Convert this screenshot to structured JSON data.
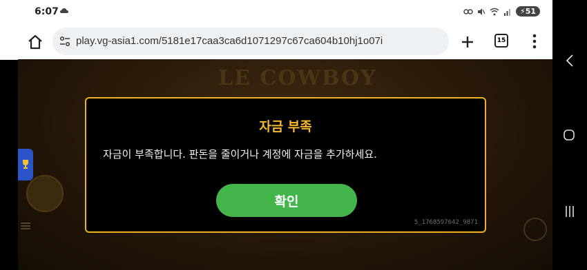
{
  "status": {
    "time": "6:07",
    "battery": "51"
  },
  "browser": {
    "url": "play.vg-asia1.com/5181e17caa3ca6d1071297c67ca604b10hj1o07i",
    "tab_count": "15"
  },
  "dialog": {
    "title": "자금 부족",
    "message": "자금이 부족합니다. 판돈을 줄이거나 계정에 자금을 추가하세요.",
    "confirm_label": "확인",
    "code": "5_1768597642_9871"
  },
  "icons": {
    "home": "home-icon",
    "site_info": "tune-icon",
    "new_tab": "plus-icon",
    "menu": "more-vert-icon",
    "nav_back": "back-icon",
    "nav_home": "circle-home-icon",
    "nav_recent": "recent-apps-icon"
  },
  "colors": {
    "dialog_border": "#f0b323",
    "dialog_title": "#f5b82e",
    "confirm_button": "#43b54a"
  }
}
